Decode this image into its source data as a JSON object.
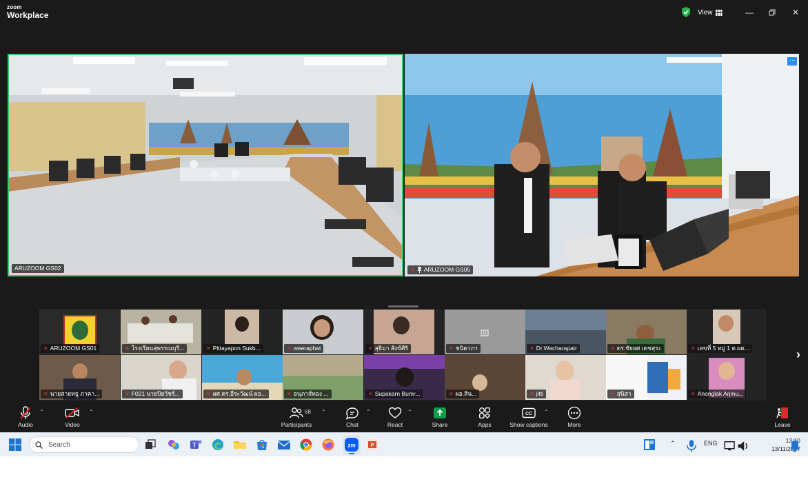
{
  "app": {
    "brand_small": "zoom",
    "brand_name": "Workplace",
    "view_label": "View"
  },
  "speakers": [
    {
      "name": "ARUZOOM GS02",
      "muted": false,
      "pinned": false
    },
    {
      "name": "ARUZOOM GS05",
      "muted": true,
      "pinned": true
    }
  ],
  "gallery": [
    {
      "name": "ARUZOOM GS01"
    },
    {
      "name": "โรงเรียนสุพรรณบุรี..."
    },
    {
      "name": "Pittayapon Sukb..."
    },
    {
      "name": "weeraphat"
    },
    {
      "name": "สุธิมา สังข์ศิริ"
    },
    {
      "name": "ชนิดาภา"
    },
    {
      "name": "Dr.Wacharapatr"
    },
    {
      "name": "ดร.ชัยยศ เดชสุระ"
    },
    {
      "name": "เลขที่ 5 หมู่ 1 ต.ผด..."
    },
    {
      "name": "นายสายทธู ภาคา..."
    },
    {
      "name": "F021 นายปิยวัชร์..."
    },
    {
      "name": "ผศ.ดร.อีระวัฒน์ ผอ..."
    },
    {
      "name": "อนุภาส์ทอง ..."
    },
    {
      "name": "Supakarn Bumr..."
    },
    {
      "name": "ผอ.สิน..."
    },
    {
      "name": "jitti"
    },
    {
      "name": "สุนิสา"
    },
    {
      "name": "Anonglak Arjmu..."
    }
  ],
  "toolbar": {
    "audio": "Audio",
    "video": "Video",
    "participants": "Participants",
    "participants_count": "68",
    "chat": "Chat",
    "react": "React",
    "share": "Share",
    "apps": "Apps",
    "captions": "Show captions",
    "more": "More",
    "leave": "Leave"
  },
  "taskbar": {
    "search_placeholder": "Search",
    "language": "ENG",
    "time": "13:10",
    "date": "13/11/2567"
  },
  "colors": {
    "active_speaker_border": "#39c96b",
    "share_green": "#0e9e4a",
    "leave_red": "#e02828",
    "zoom_bg": "#1a1a1a"
  }
}
